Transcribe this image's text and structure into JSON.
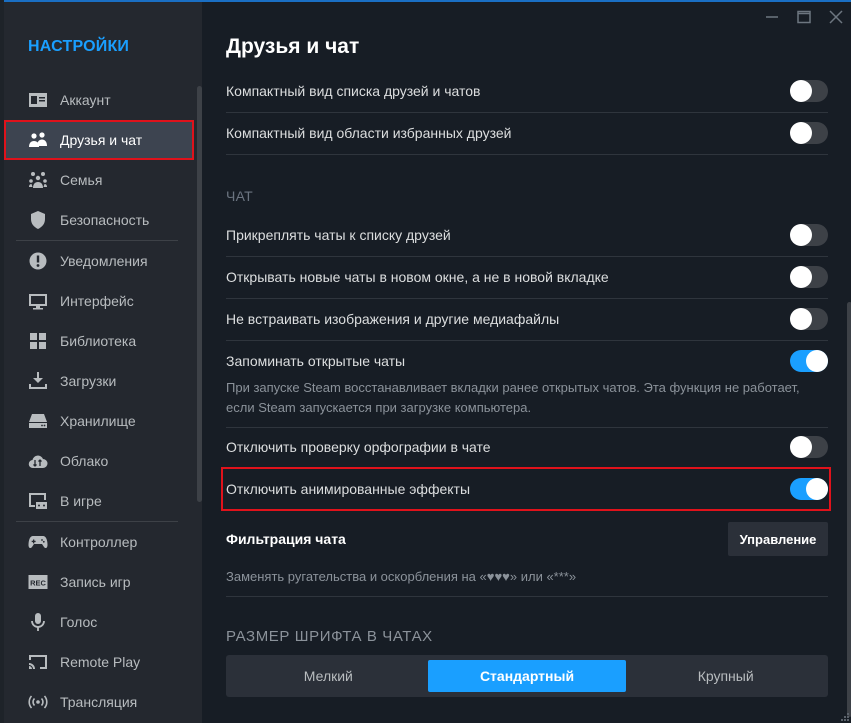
{
  "sidebar": {
    "title": "НАСТРОЙКИ",
    "items": [
      {
        "label": "Аккаунт",
        "icon": "account-card-icon"
      },
      {
        "label": "Друзья и чат",
        "icon": "friends-icon",
        "active": true
      },
      {
        "label": "Семья",
        "icon": "family-icon"
      },
      {
        "label": "Безопасность",
        "icon": "shield-icon"
      },
      {
        "label": "Уведомления",
        "icon": "alert-icon"
      },
      {
        "label": "Интерфейс",
        "icon": "monitor-icon"
      },
      {
        "label": "Библиотека",
        "icon": "grid-icon"
      },
      {
        "label": "Загрузки",
        "icon": "download-icon"
      },
      {
        "label": "Хранилище",
        "icon": "storage-icon"
      },
      {
        "label": "Облако",
        "icon": "cloud-sync-icon"
      },
      {
        "label": "В игре",
        "icon": "in-game-icon"
      },
      {
        "label": "Контроллер",
        "icon": "gamepad-icon"
      },
      {
        "label": "Запись игр",
        "icon": "rec-icon"
      },
      {
        "label": "Голос",
        "icon": "microphone-icon"
      },
      {
        "label": "Remote Play",
        "icon": "cast-icon"
      },
      {
        "label": "Трансляция",
        "icon": "broadcast-icon"
      }
    ]
  },
  "window_controls": {
    "minimize": "minimize-icon",
    "maximize": "maximize-icon",
    "close": "close-icon"
  },
  "main": {
    "title": "Друзья и чат",
    "settings_top": [
      {
        "label": "Компактный вид списка друзей и чатов",
        "on": false
      },
      {
        "label": "Компактный вид области избранных друзей",
        "on": false
      }
    ],
    "chat_section": {
      "heading": "ЧАТ",
      "settings": [
        {
          "label": "Прикреплять чаты к списку друзей",
          "on": false
        },
        {
          "label": "Открывать новые чаты в новом окне, а не в новой вкладке",
          "on": false
        },
        {
          "label": "Не встраивать изображения и другие медиафайлы",
          "on": false
        },
        {
          "label": "Запоминать открытые чаты",
          "on": true,
          "description": "При запуске Steam восстанавливает вкладки ранее открытых чатов. Эта функция не работает, если Steam запускается при загрузке компьютера."
        },
        {
          "label": "Отключить проверку орфографии в чате",
          "on": false
        },
        {
          "label": "Отключить анимированные эффекты",
          "on": true
        }
      ]
    },
    "filter": {
      "label": "Фильтрация чата",
      "button": "Управление",
      "description": "Заменять ругательства и оскорбления на «♥♥♥» или «***»"
    },
    "font_size": {
      "heading": "РАЗМЕР ШРИФТА В ЧАТАХ",
      "options": [
        "Мелкий",
        "Стандартный",
        "Крупный"
      ],
      "selected": "Стандартный"
    }
  },
  "colors": {
    "accent": "#1a9fff",
    "highlight": "#e0121b",
    "background": "#171d25",
    "sidebar": "#24282f"
  }
}
